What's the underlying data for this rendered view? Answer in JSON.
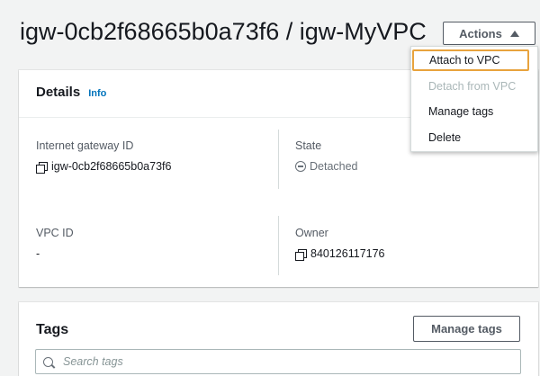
{
  "header": {
    "title": "igw-0cb2f68665b0a73f6 / igw-MyVPC",
    "actions_label": "Actions"
  },
  "actions_menu": {
    "items": [
      {
        "label": "Attach to VPC",
        "state": "focused"
      },
      {
        "label": "Detach from VPC",
        "state": "disabled"
      },
      {
        "label": "Manage tags",
        "state": "enabled"
      },
      {
        "label": "Delete",
        "state": "enabled"
      }
    ]
  },
  "details": {
    "title": "Details",
    "info_label": "Info",
    "fields": {
      "internet_gateway_id": {
        "label": "Internet gateway ID",
        "value": "igw-0cb2f68665b0a73f6",
        "icon": "copy-icon"
      },
      "state": {
        "label": "State",
        "value": "Detached",
        "icon": "detached-icon"
      },
      "vpc_id": {
        "label": "VPC ID",
        "value": "-"
      },
      "owner": {
        "label": "Owner",
        "value": "840126117176",
        "icon": "copy-icon"
      }
    }
  },
  "tags": {
    "title": "Tags",
    "manage_label": "Manage tags",
    "search_placeholder": "Search tags",
    "search_value": ""
  },
  "colors": {
    "page_background": "#f2f3f3",
    "panel_background": "#ffffff",
    "link_blue": "#0073bb",
    "focus_orange": "#e8a33d",
    "button_border": "#545b64",
    "muted_text": "#687078",
    "disabled_text": "#aab7b8"
  }
}
